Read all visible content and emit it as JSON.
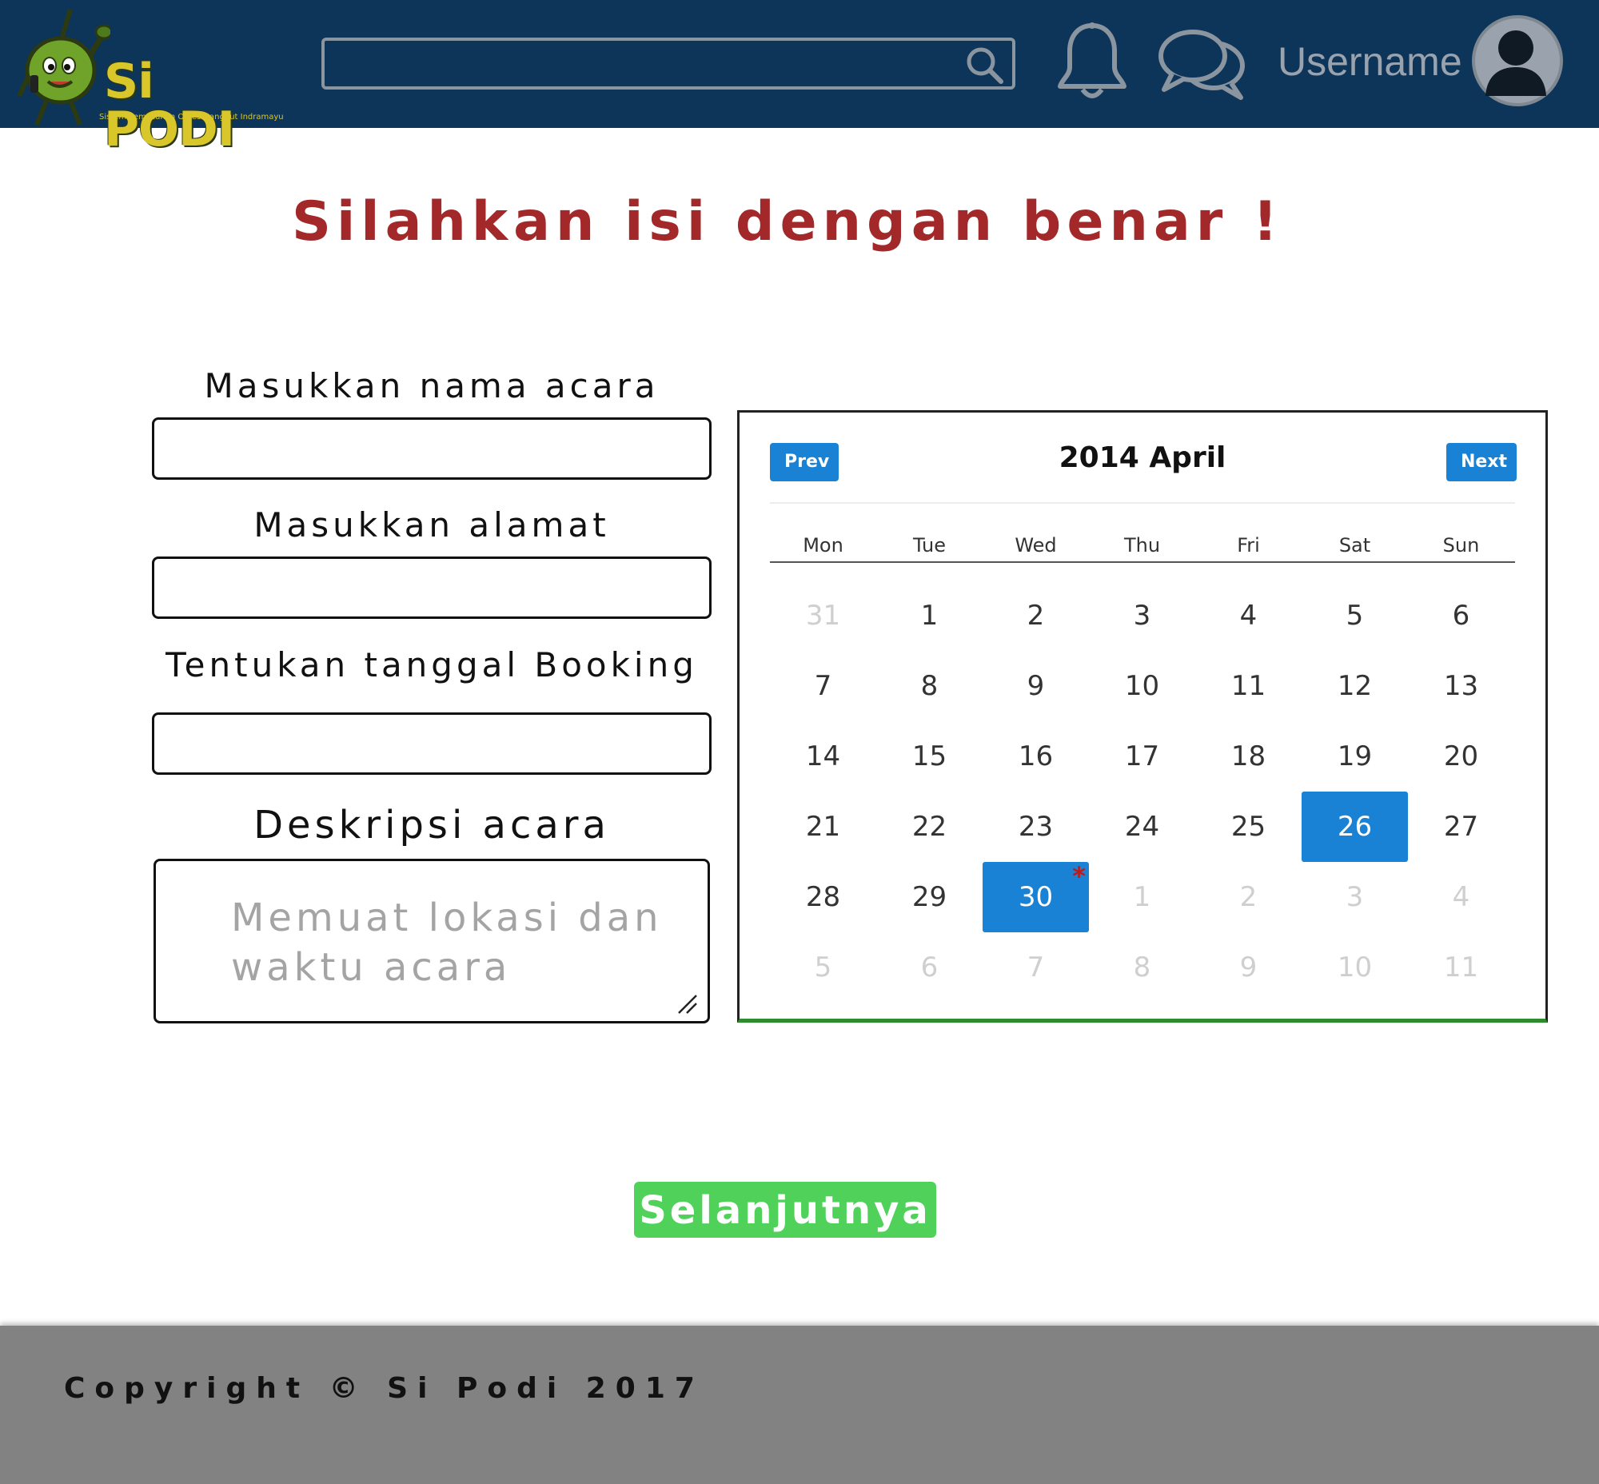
{
  "header": {
    "logo_text": "Si PODI",
    "logo_subtitle": "Sistem Pemesanan Orkes Dangdut Indramayu",
    "search_value": "",
    "username": "Username",
    "colors": {
      "bar": "#0d3459",
      "logo": "#d9c62a"
    },
    "icons": [
      "search-icon",
      "bell-icon",
      "chat-icon",
      "avatar-icon"
    ]
  },
  "title": "Silahkan isi dengan benar !",
  "form": {
    "event_name_label": "Masukkan nama acara",
    "event_name_value": "",
    "address_label": "Masukkan alamat",
    "address_value": "",
    "booking_date_label": "Tentukan tanggal Booking",
    "booking_date_value": "",
    "description_label": "Deskripsi acara",
    "description_placeholder": "Memuat lokasi dan waktu acara"
  },
  "calendar": {
    "prev_label": "Prev",
    "next_label": "Next",
    "title": "2014 April",
    "weekdays": [
      "Mon",
      "Tue",
      "Wed",
      "Thu",
      "Fri",
      "Sat",
      "Sun"
    ],
    "weeks": [
      [
        {
          "d": "31",
          "m": true
        },
        {
          "d": "1"
        },
        {
          "d": "2"
        },
        {
          "d": "3"
        },
        {
          "d": "4"
        },
        {
          "d": "5"
        },
        {
          "d": "6"
        }
      ],
      [
        {
          "d": "7"
        },
        {
          "d": "8"
        },
        {
          "d": "9"
        },
        {
          "d": "10"
        },
        {
          "d": "11"
        },
        {
          "d": "12"
        },
        {
          "d": "13"
        }
      ],
      [
        {
          "d": "14"
        },
        {
          "d": "15"
        },
        {
          "d": "16"
        },
        {
          "d": "17"
        },
        {
          "d": "18"
        },
        {
          "d": "19"
        },
        {
          "d": "20"
        }
      ],
      [
        {
          "d": "21"
        },
        {
          "d": "22"
        },
        {
          "d": "23"
        },
        {
          "d": "24"
        },
        {
          "d": "25"
        },
        {
          "d": "26",
          "sel": true
        },
        {
          "d": "27"
        }
      ],
      [
        {
          "d": "28"
        },
        {
          "d": "29"
        },
        {
          "d": "30",
          "sel": true,
          "mark": true
        },
        {
          "d": "1",
          "m": true
        },
        {
          "d": "2",
          "m": true
        },
        {
          "d": "3",
          "m": true
        },
        {
          "d": "4",
          "m": true
        }
      ],
      [
        {
          "d": "5",
          "m": true
        },
        {
          "d": "6",
          "m": true
        },
        {
          "d": "7",
          "m": true
        },
        {
          "d": "8",
          "m": true
        },
        {
          "d": "9",
          "m": true
        },
        {
          "d": "10",
          "m": true
        },
        {
          "d": "11",
          "m": true
        }
      ]
    ],
    "marker_symbol": "*",
    "colors": {
      "selected": "#1a82d4",
      "marker": "#c21818"
    }
  },
  "next_button_label": "Selanjutnya",
  "footer": {
    "copyright": "Copyright © Si Podi 2017"
  },
  "colors": {
    "title": "#a3282a",
    "next_button": "#4fd15a",
    "footer": "#828282"
  }
}
